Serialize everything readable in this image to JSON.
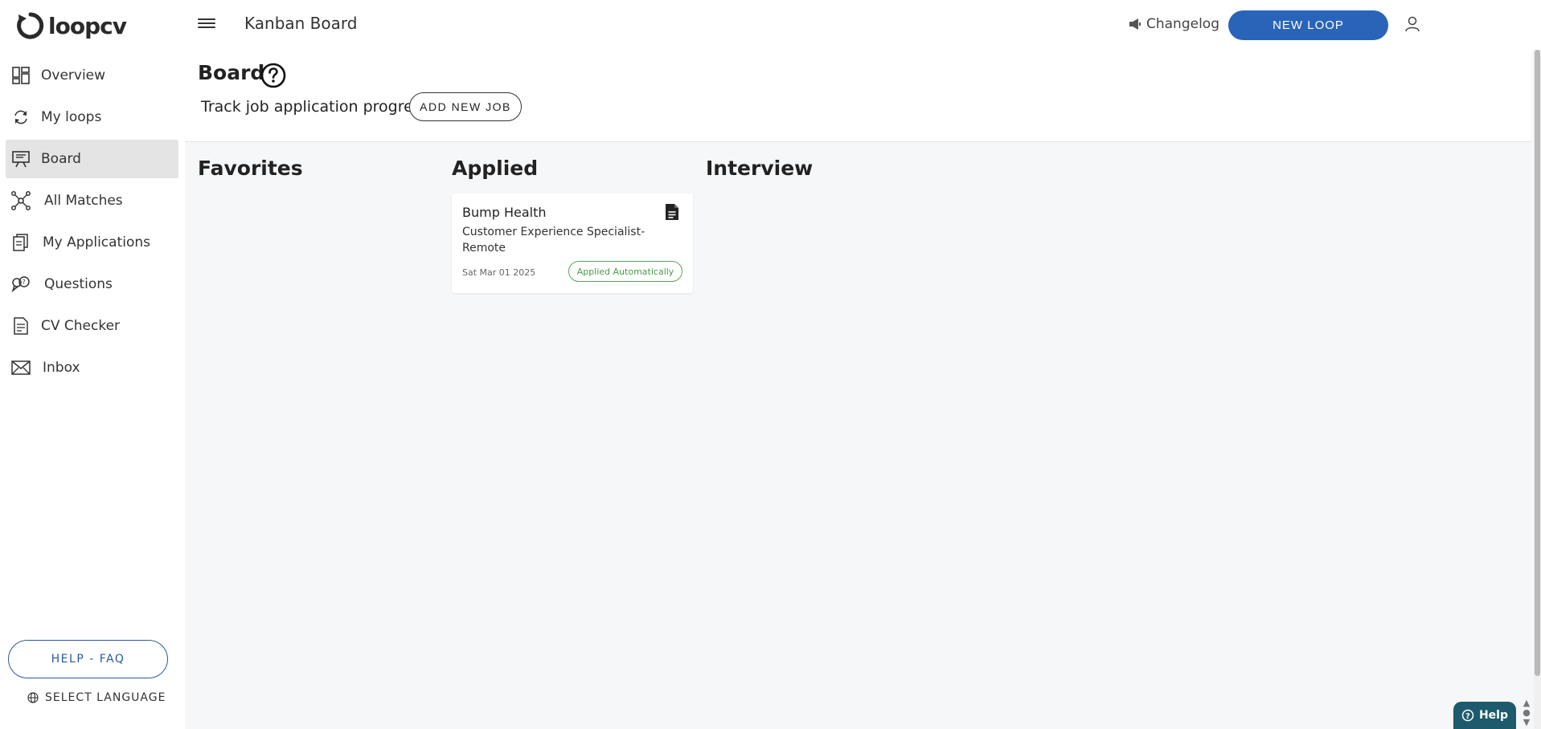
{
  "topbar": {
    "logo_text": "loopcv",
    "page_heading": "Kanban Board",
    "changelog_label": "Changelog",
    "new_loop_label": "NEW LOOP"
  },
  "sidebar": {
    "items": [
      {
        "label": "Overview",
        "icon": "dashboard-icon"
      },
      {
        "label": "My loops",
        "icon": "loop-icon"
      },
      {
        "label": "Board",
        "icon": "board-icon",
        "active": true
      },
      {
        "label": "All Matches",
        "icon": "network-icon"
      },
      {
        "label": "My Applications",
        "icon": "applications-icon"
      },
      {
        "label": "Questions",
        "icon": "questions-icon"
      },
      {
        "label": "CV Checker",
        "icon": "cv-checker-icon"
      },
      {
        "label": "Inbox",
        "icon": "mail-icon"
      }
    ],
    "help_faq_label": "HELP - FAQ",
    "select_language_label": "SELECT LANGUAGE"
  },
  "board": {
    "title": "Board",
    "subtitle": "Track job application progress",
    "add_job_label": "ADD NEW JOB",
    "columns": [
      "Favorites",
      "Applied",
      "Interview"
    ]
  },
  "job_card": {
    "company": "Bump Health",
    "title": "Customer Experience Specialist- Remote",
    "date": "Sat Mar 01 2025",
    "status": "Applied Automatically"
  },
  "help_widget_label": "Help",
  "colors": {
    "primary": "#2a64b9",
    "active_nav": "#e4e4e4",
    "badge_green": "#4a9a4a",
    "help_widget": "#1d5a6b"
  }
}
